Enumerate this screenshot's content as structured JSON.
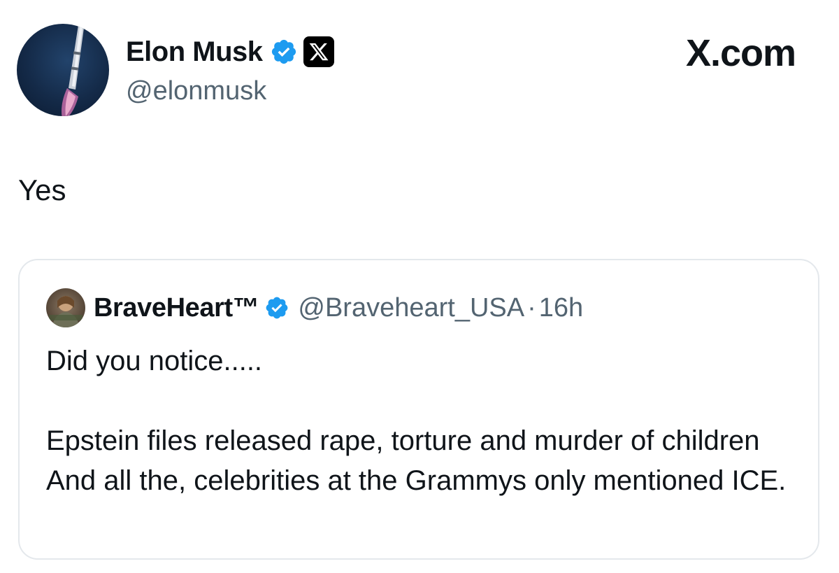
{
  "author": {
    "display_name": "Elon Musk",
    "handle": "@elonmusk",
    "avatar_icon": "rocket-launch-avatar",
    "verified_badge_icon": "verified-badge-icon",
    "affiliate_badge_icon": "x-logo-icon"
  },
  "brand": {
    "label": "X.com"
  },
  "tweet": {
    "text": "Yes"
  },
  "quoted_tweet": {
    "display_name": "BraveHeart™",
    "handle": "@Braveheart_USA",
    "separator": "·",
    "time": "16h",
    "line_1": "Did you notice.....",
    "line_2": "Epstein files released rape, torture and murder of children And all the, celebrities at the Grammys only mentioned ICE.",
    "avatar_icon": "braveheart-avatar",
    "verified_badge_icon": "verified-badge-icon"
  },
  "colors": {
    "verified_blue": "#1d9bf0",
    "secondary_text": "#536471",
    "primary_text": "#0f1419",
    "card_border": "#e4e8ec"
  }
}
